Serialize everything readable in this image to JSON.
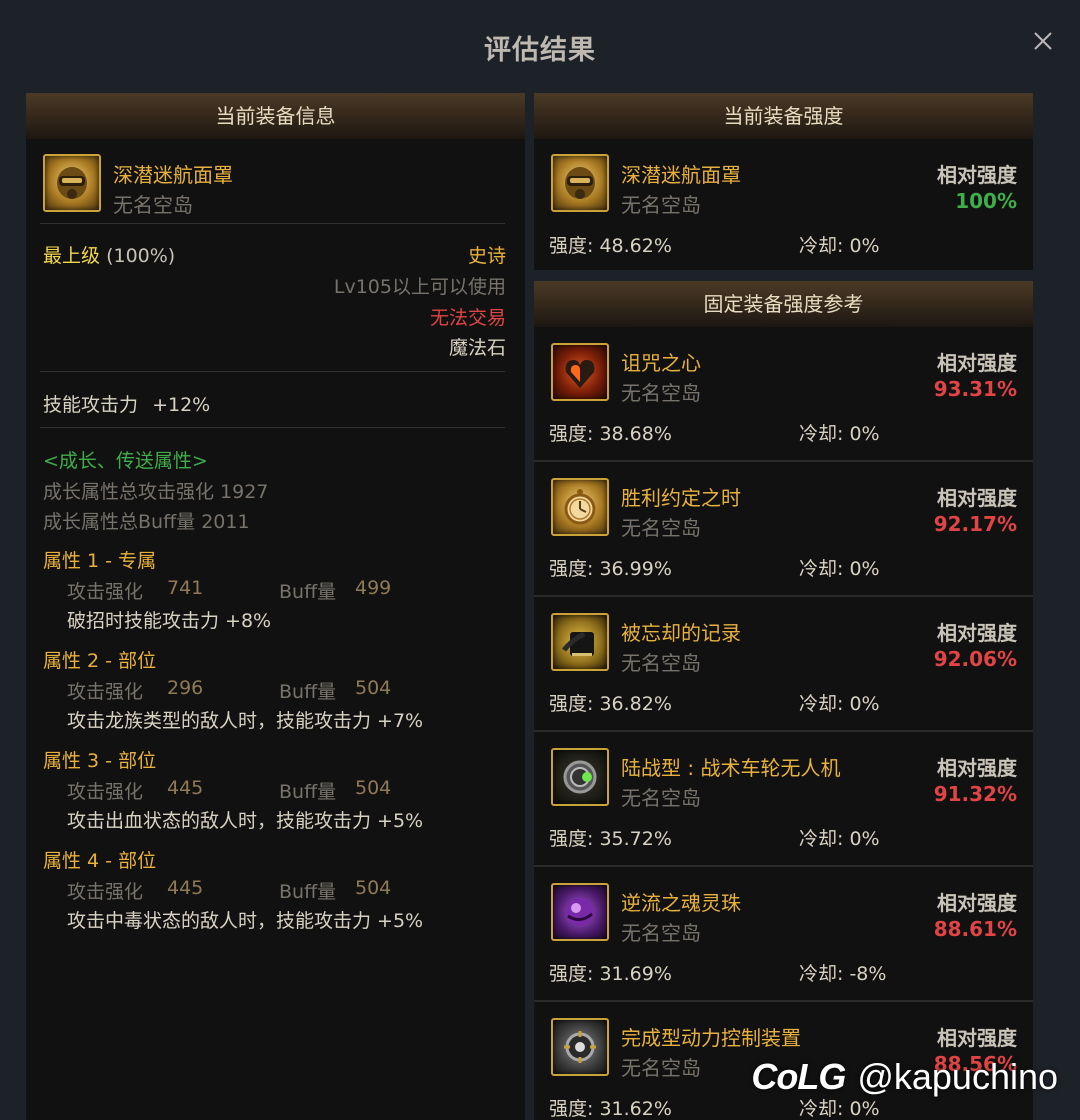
{
  "dialog": {
    "title": "评估结果"
  },
  "left": {
    "header": "当前装备信息",
    "item": {
      "name": "深潜迷航面罩",
      "source": "无名空岛"
    },
    "grade": "最上级",
    "grade_pct": "(100%)",
    "rarity": "史诗",
    "level_req": "Lv105以上可以使用",
    "trade": "无法交易",
    "material": "魔法石",
    "skill_attack": "技能攻击力",
    "skill_attack_val": "+12%",
    "growth_title": "<成长、传送属性>",
    "growth_attack": "成长属性总攻击强化 1927",
    "growth_buff": "成长属性总Buff量 2011",
    "attributes": [
      {
        "title": "属性 1 - 专属",
        "atk_label": "攻击强化",
        "atk": "741",
        "buff_label": "Buff量",
        "buff": "499",
        "effect": "破招时技能攻击力 +8%"
      },
      {
        "title": "属性 2 - 部位",
        "atk_label": "攻击强化",
        "atk": "296",
        "buff_label": "Buff量",
        "buff": "504",
        "effect": "攻击龙族类型的敌人时，技能攻击力 +7%"
      },
      {
        "title": "属性 3 - 部位",
        "atk_label": "攻击强化",
        "atk": "445",
        "buff_label": "Buff量",
        "buff": "504",
        "effect": "攻击出血状态的敌人时，技能攻击力 +5%"
      },
      {
        "title": "属性 4 - 部位",
        "atk_label": "攻击强化",
        "atk": "445",
        "buff_label": "Buff量",
        "buff": "504",
        "effect": "攻击中毒状态的敌人时，技能攻击力 +5%"
      }
    ]
  },
  "current": {
    "header": "当前装备强度",
    "name": "深潜迷航面罩",
    "source": "无名空岛",
    "rel_label": "相对强度",
    "rel_value": "100%",
    "strength": "强度: 48.62%",
    "cooldown": "冷却: 0%"
  },
  "fixed": {
    "header": "固定装备强度参考",
    "items": [
      {
        "name": "诅咒之心",
        "source": "无名空岛",
        "rel_label": "相对强度",
        "rel_value": "93.31%",
        "strength": "强度: 38.68%",
        "cooldown": "冷却: 0%",
        "icon": "cursed-heart-icon"
      },
      {
        "name": "胜利约定之时",
        "source": "无名空岛",
        "rel_label": "相对强度",
        "rel_value": "92.17%",
        "strength": "强度: 36.99%",
        "cooldown": "冷却: 0%",
        "icon": "pocket-watch-icon"
      },
      {
        "name": "被忘却的记录",
        "source": "无名空岛",
        "rel_label": "相对强度",
        "rel_value": "92.06%",
        "strength": "强度: 36.82%",
        "cooldown": "冷却: 0%",
        "icon": "forgotten-record-icon"
      },
      {
        "name": "陆战型 : 战术车轮无人机",
        "source": "无名空岛",
        "rel_label": "相对强度",
        "rel_value": "91.32%",
        "strength": "强度: 35.72%",
        "cooldown": "冷却: 0%",
        "icon": "wheel-drone-icon"
      },
      {
        "name": "逆流之魂灵珠",
        "source": "无名空岛",
        "rel_label": "相对强度",
        "rel_value": "88.61%",
        "strength": "强度: 31.69%",
        "cooldown": "冷却: -8%",
        "icon": "spirit-orb-icon"
      },
      {
        "name": "完成型动力控制装置",
        "source": "无名空岛",
        "rel_label": "相对强度",
        "rel_value": "88.56%",
        "strength": "强度: 31.62%",
        "cooldown": "冷却: 0%",
        "icon": "power-control-device-icon"
      }
    ]
  },
  "watermark": {
    "logo": "CoLG",
    "user": "@kapuchino"
  },
  "colors": {
    "gold": "#e8b13e",
    "yellow": "#f2d84a",
    "green": "#3fae4a",
    "red": "#e04444",
    "grey": "#77736b",
    "attr_val": "#8f7a55"
  }
}
